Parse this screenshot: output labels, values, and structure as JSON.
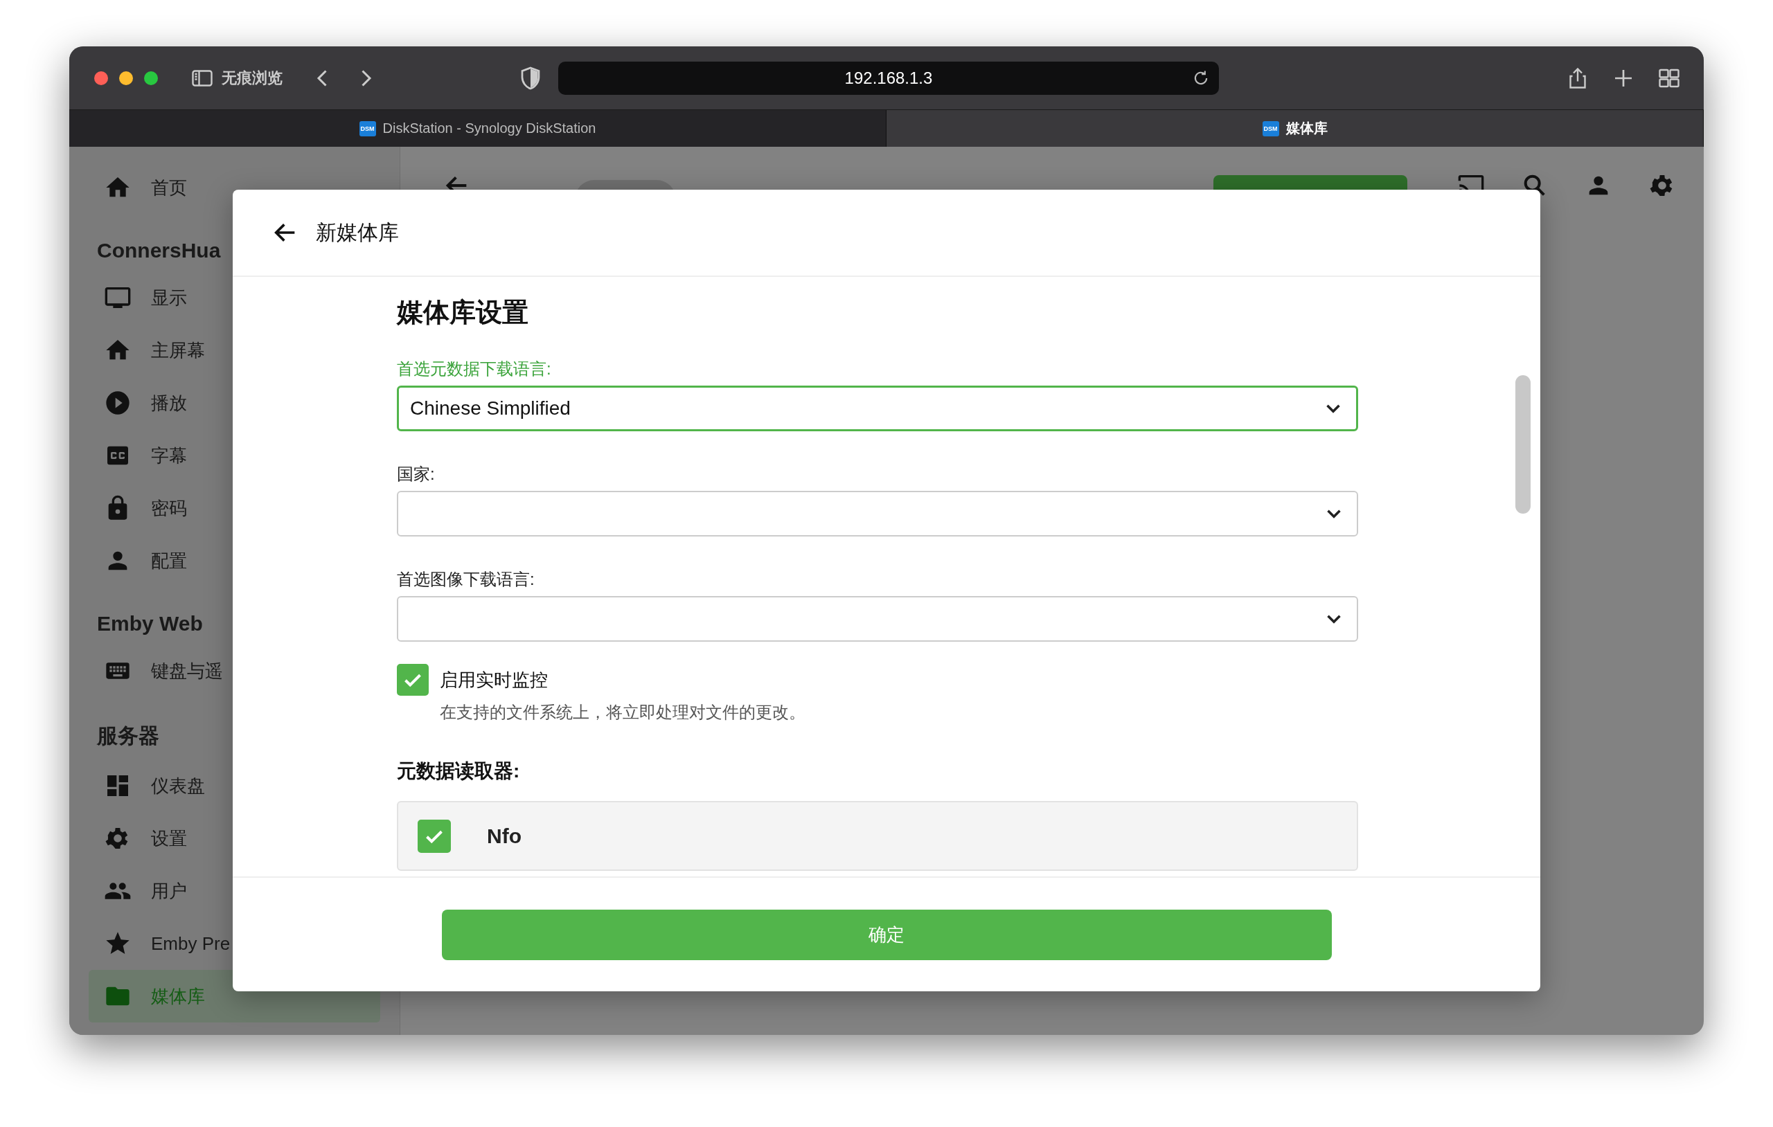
{
  "browser": {
    "private_label": "无痕浏览",
    "address": "192.168.1.3",
    "tabs": [
      {
        "title": "DiskStation - Synology DiskStation",
        "favicon": "DSM",
        "selected": false
      },
      {
        "title": "媒体库",
        "favicon": "DSM",
        "selected": true
      }
    ]
  },
  "sidebar": {
    "sections": [
      {
        "items": [
          {
            "label": "首页",
            "kind": "home",
            "selected": false
          }
        ]
      },
      {
        "heading": "ConnersHua",
        "items": [
          {
            "label": "显示",
            "kind": "monitor",
            "selected": false
          },
          {
            "label": "主屏幕",
            "kind": "home",
            "selected": false
          },
          {
            "label": "播放",
            "kind": "play",
            "selected": false
          },
          {
            "label": "字幕",
            "kind": "cc",
            "selected": false
          },
          {
            "label": "密码",
            "kind": "lock",
            "selected": false
          },
          {
            "label": "配置",
            "kind": "person",
            "selected": false
          }
        ]
      },
      {
        "heading": "Emby Web",
        "items": [
          {
            "label": "键盘与遥",
            "kind": "keyboard",
            "selected": false
          }
        ]
      },
      {
        "heading": "服务器",
        "items": [
          {
            "label": "仪表盘",
            "kind": "dashboard",
            "selected": false
          },
          {
            "label": "设置",
            "kind": "gear",
            "selected": false
          },
          {
            "label": "用户",
            "kind": "people",
            "selected": false
          },
          {
            "label": "Emby Pre",
            "kind": "star",
            "selected": false
          },
          {
            "label": "媒体库",
            "kind": "folder",
            "selected": true
          }
        ]
      }
    ]
  },
  "dialog": {
    "title": "新媒体库",
    "section_title": "媒体库设置",
    "fields": [
      {
        "label": "首选元数据下载语言:",
        "value": "Chinese Simplified",
        "focused": true
      },
      {
        "label": "国家:",
        "focused": false
      },
      {
        "label": "首选图像下载语言:",
        "focused": false
      }
    ],
    "realtime_monitor": {
      "label": "启用实时监控",
      "description": "在支持的文件系统上，将立即处理对文件的更改。",
      "checked": true
    },
    "metadata_readers": {
      "heading": "元数据读取器:",
      "items": [
        {
          "name": "Nfo",
          "checked": true
        }
      ]
    },
    "confirm_button": "确定"
  }
}
